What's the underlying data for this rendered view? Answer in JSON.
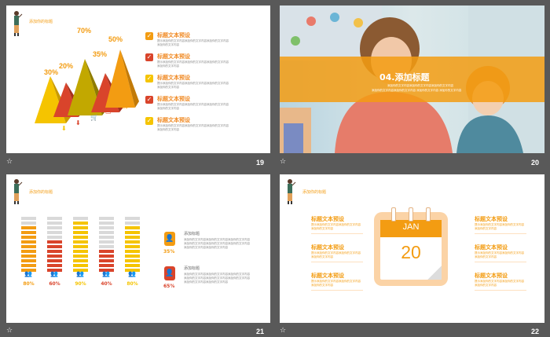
{
  "slides": [
    {
      "number": "19",
      "header": "添加你的标题",
      "percents": [
        "30%",
        "20%",
        "70%",
        "35%",
        "50%"
      ],
      "items": [
        {
          "title": "标题文本预设",
          "desc1": "提示添加你的文字内容添加你的文字内容添加你的文字内容",
          "desc2": "添加你的文字内容",
          "color": "#f39c12"
        },
        {
          "title": "标题文本预设",
          "desc1": "提示添加你的文字内容添加你的文字内容添加你的文字内容",
          "desc2": "添加你的文字内容",
          "color": "#d9442b"
        },
        {
          "title": "标题文本预设",
          "desc1": "提示添加你的文字内容添加你的文字内容添加你的文字内容",
          "desc2": "添加你的文字内容",
          "color": "#f5c400"
        },
        {
          "title": "标题文本预设",
          "desc1": "提示添加你的文字内容添加你的文字内容添加你的文字内容",
          "desc2": "添加你的文字内容",
          "color": "#d9442b"
        },
        {
          "title": "标题文本预设",
          "desc1": "提示添加你的文字内容添加你的文字内容添加你的文字内容",
          "desc2": "添加你的文字内容",
          "color": "#f5c400"
        }
      ]
    },
    {
      "number": "20",
      "title": "04.添加标题",
      "sub1": "添加你的文字内容添加你的文字内容添加你的文字内容",
      "sub2": "添加你的文字内容添加你的文字内容 添加你的文字内容 添加你的文字内容"
    },
    {
      "number": "21",
      "header": "添加你的标题",
      "bars": [
        {
          "label": "80%",
          "color": "#f39c12",
          "fill": 0.8
        },
        {
          "label": "60%",
          "color": "#d9442b",
          "fill": 0.6
        },
        {
          "label": "90%",
          "color": "#f5c400",
          "fill": 0.9
        },
        {
          "label": "40%",
          "color": "#d9442b",
          "fill": 0.4
        },
        {
          "label": "80%",
          "color": "#f5c400",
          "fill": 0.8
        }
      ],
      "stats": [
        {
          "title": "添加标题",
          "pct": "35%",
          "color": "#f39c12",
          "lines": [
            "添加你的文字内容添加你的文字内容添加你的文字内容",
            "添加你的文字内容添加你的文字内容添加你的文字内容",
            "添加你的文字内容添加你的文字内容"
          ]
        },
        {
          "title": "添加标题",
          "pct": "65%",
          "color": "#d9442b",
          "lines": [
            "添加你的文字内容添加你的文字内容添加你的文字内容",
            "添加你的文字内容添加你的文字内容添加你的文字内容",
            "添加你的文字内容添加你的文字内容"
          ]
        }
      ]
    },
    {
      "number": "22",
      "header": "添加你的标题",
      "calendar": {
        "month": "JAN",
        "day": "20"
      },
      "items": [
        {
          "title": "标题文本预设",
          "l1": "提示添加你的文字内容添加你的文字内容",
          "l2": "添加你的文字内容"
        },
        {
          "title": "标题文本预设",
          "l1": "提示添加你的文字内容添加你的文字内容",
          "l2": "添加你的文字内容"
        },
        {
          "title": "标题文本预设",
          "l1": "提示添加你的文字内容添加你的文字内容",
          "l2": "添加你的文字内容"
        },
        {
          "title": "标题文本预设",
          "l1": "提示添加你的文字内容添加你的文字内容",
          "l2": "添加你的文字内容"
        },
        {
          "title": "标题文本预设",
          "l1": "提示添加你的文字内容添加你的文字内容",
          "l2": "添加你的文字内容"
        },
        {
          "title": "标题文本预设",
          "l1": "提示添加你的文字内容添加你的文字内容",
          "l2": "添加你的文字内容"
        }
      ]
    }
  ]
}
